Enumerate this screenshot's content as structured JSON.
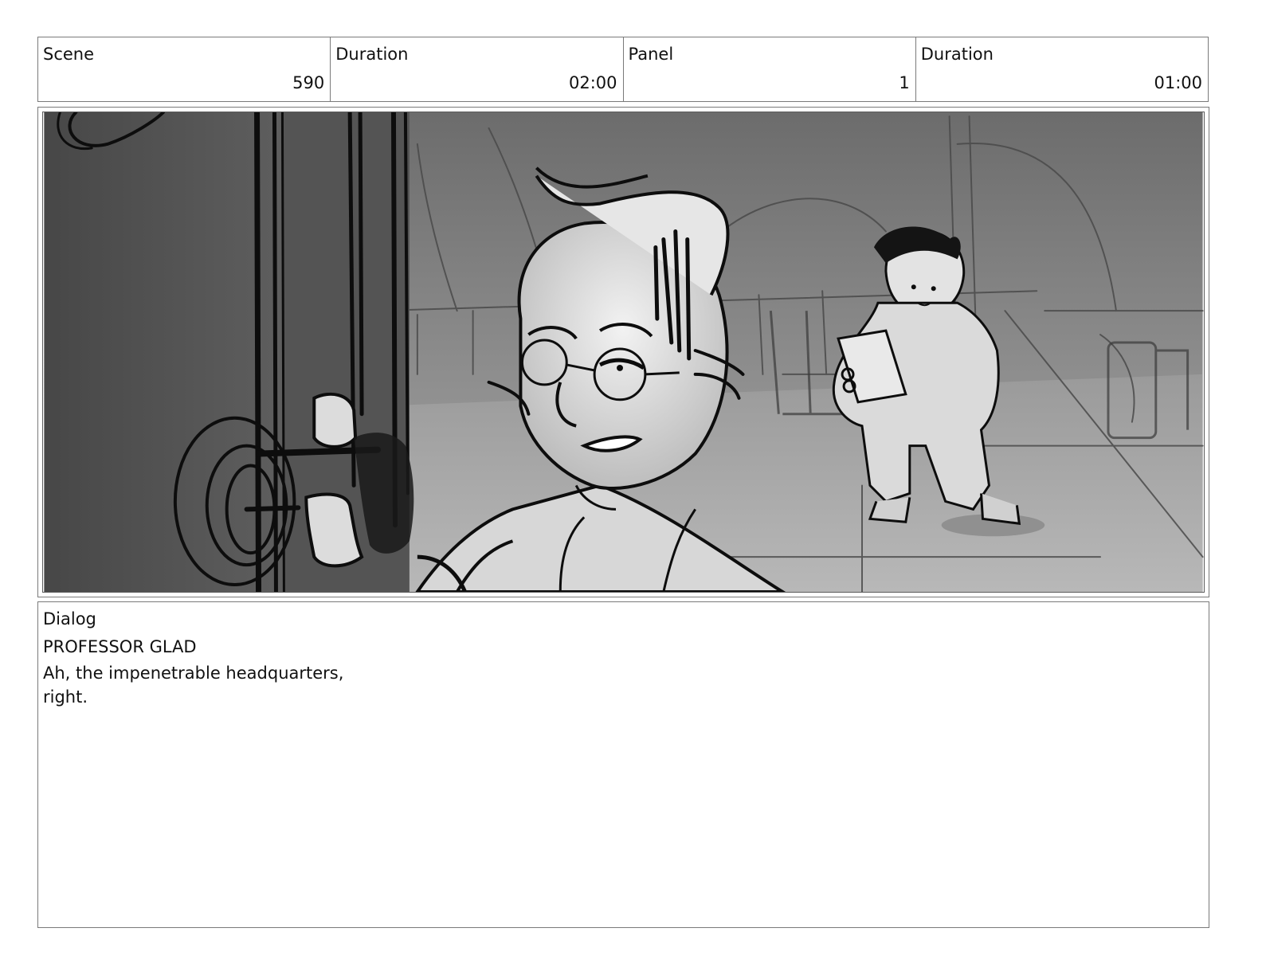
{
  "header": {
    "cells": [
      {
        "label": "Scene",
        "value": "590"
      },
      {
        "label": "Duration",
        "value": "02:00"
      },
      {
        "label": "Panel",
        "value": "1"
      },
      {
        "label": "Duration",
        "value": "01:00"
      }
    ]
  },
  "dialog": {
    "label": "Dialog",
    "speaker": "PROFESSOR GLAD",
    "lines": [
      "Ah, the impenetrable headquarters,",
      "right."
    ]
  }
}
